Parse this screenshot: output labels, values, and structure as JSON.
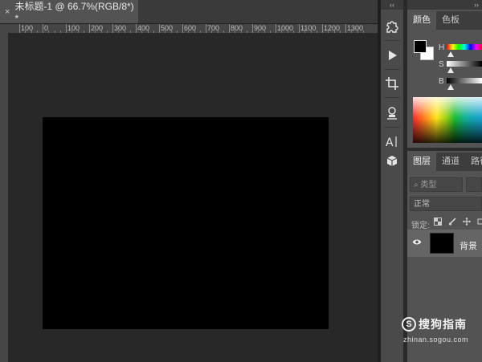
{
  "document_tab": {
    "close_icon": "×",
    "title": "未标题-1 @ 66.7%(RGB/8*) *"
  },
  "ruler": {
    "top_labels": [
      "100",
      "0",
      "100",
      "200",
      "300",
      "400",
      "500",
      "600",
      "700",
      "800",
      "900",
      "1000",
      "1100",
      "1200",
      "1300"
    ]
  },
  "tools_panel": {
    "collapse_icon": "‹‹",
    "tools": [
      "puzzle-icon",
      "play-icon",
      "crop-icon",
      "stamp-icon",
      "type-icon",
      "cube-icon"
    ]
  },
  "right_panel": {
    "collapse_icon": "››",
    "color_tabs": [
      {
        "label": "颜色",
        "active": true
      },
      {
        "label": "色板",
        "active": false
      }
    ],
    "sliders": [
      {
        "label": "H"
      },
      {
        "label": "S"
      },
      {
        "label": "B"
      }
    ],
    "layers_tabs": [
      {
        "label": "图层",
        "active": true
      },
      {
        "label": "通道",
        "active": false
      },
      {
        "label": "路径",
        "active": false
      }
    ],
    "filter_placeholder": "类型",
    "blend_mode": "正常",
    "lock_label": "锁定:",
    "layer": {
      "name": "背景",
      "visible": true
    }
  },
  "watermark": {
    "logo_letter": "S",
    "text": "搜狗指南",
    "url": "zhinan.sogou.com"
  },
  "colors": {
    "foreground": "#000000",
    "background": "#ffffff",
    "canvas": "#000000"
  }
}
